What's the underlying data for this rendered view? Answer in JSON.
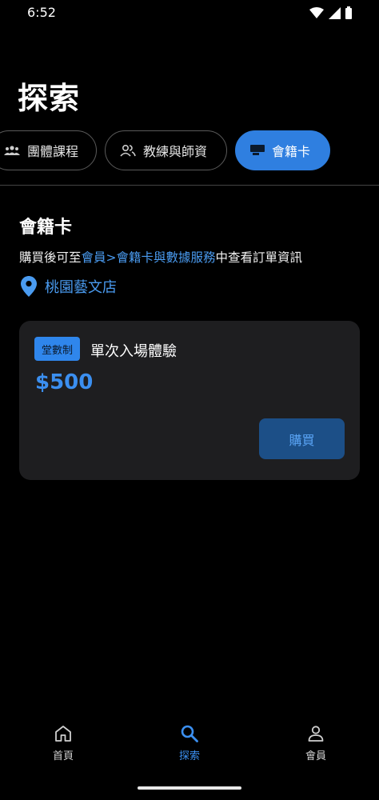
{
  "status_bar": {
    "time": "6:52"
  },
  "header": {
    "title": "探索"
  },
  "tabs": [
    {
      "label": "團體課程",
      "icon": "group-icon"
    },
    {
      "label": "教練與師資",
      "icon": "people-icon"
    },
    {
      "label": "會籍卡",
      "icon": "card-icon",
      "active": true
    }
  ],
  "section": {
    "title": "會籍卡",
    "desc_prefix": "購買後可至",
    "desc_link": "會員>會籍卡與數據服務",
    "desc_suffix": "中查看訂單資訊",
    "location": "桃園藝文店"
  },
  "card": {
    "badge": "堂數制",
    "name": "單次入場體驗",
    "price": "$500",
    "buy_label": "購買"
  },
  "bottom_nav": [
    {
      "label": "首頁",
      "icon": "home-icon"
    },
    {
      "label": "探索",
      "icon": "search-icon",
      "active": true
    },
    {
      "label": "會員",
      "icon": "person-icon"
    }
  ],
  "colors": {
    "accent": "#2f7fe0",
    "link": "#4a9bf0",
    "card_bg": "#1e1e20"
  }
}
